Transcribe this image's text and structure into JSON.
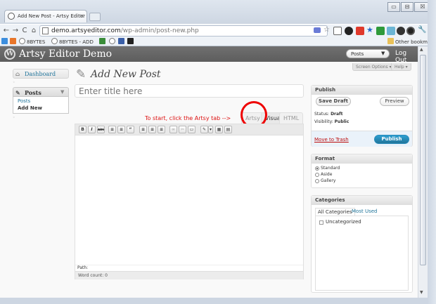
{
  "browser": {
    "tab_title": "Add New Post - Artsy Editor",
    "tab_close": "×",
    "window_buttons": [
      "▭",
      "⊟",
      "☒"
    ],
    "nav": {
      "back": "←",
      "forward": "→",
      "reload": "C",
      "home": "⌂"
    },
    "url_host": "demo.artsyeditor.com",
    "url_path": "/wp-admin/post-new.php",
    "bookmarks": [
      "8BYTES",
      "8BYTES - ADD"
    ],
    "other_bookmarks": "Other bookmarks",
    "wrench": "🔧"
  },
  "wp": {
    "logo_glyph": "W",
    "site_title": "Artsy Editor Demo",
    "favorites_value": "Posts",
    "logout": "Log Out",
    "screen_options": "Screen Options ▾",
    "help": "Help ▾",
    "menu": {
      "dashboard": "Dashboard",
      "posts": "Posts",
      "posts_arrow": "▼",
      "sub_posts": "Posts",
      "sub_add_new": "Add New",
      "separator": "◦"
    },
    "page_title": "Add New Post",
    "title_placeholder": "Enter title here",
    "hint": "To start, click the Artsy tab -->",
    "editor_tabs": {
      "artsy": "Artsy",
      "visual": "Visual",
      "html": "HTML"
    },
    "toolbar": [
      "B",
      "I",
      "ABC",
      "≡",
      "≡",
      "“",
      "≡",
      "≡",
      "≡",
      "∞",
      "✂",
      "▭",
      "✎",
      "▾",
      "▦",
      "▤"
    ],
    "path_label": "Path:",
    "word_count": "Word count: 0",
    "publish": {
      "title": "Publish",
      "save_draft": "Save Draft",
      "preview": "Preview",
      "status_label": "Status:",
      "status_value": "Draft",
      "visibility_label": "Visibility:",
      "visibility_value": "Public",
      "move_to_trash": "Move to Trash",
      "publish_button": "Publish"
    },
    "format": {
      "title": "Format",
      "options": [
        "Standard",
        "Aside",
        "Gallery"
      ],
      "selected": "Standard"
    },
    "categories": {
      "title": "Categories",
      "tab_all": "All Categories",
      "tab_used": "Most Used",
      "items": [
        "Uncategorized"
      ]
    }
  },
  "colors": {
    "annotation_circle": "#e00000",
    "hint_text": "#dd1111",
    "link_blue": "#21759b",
    "publish_button": "#21759b"
  }
}
